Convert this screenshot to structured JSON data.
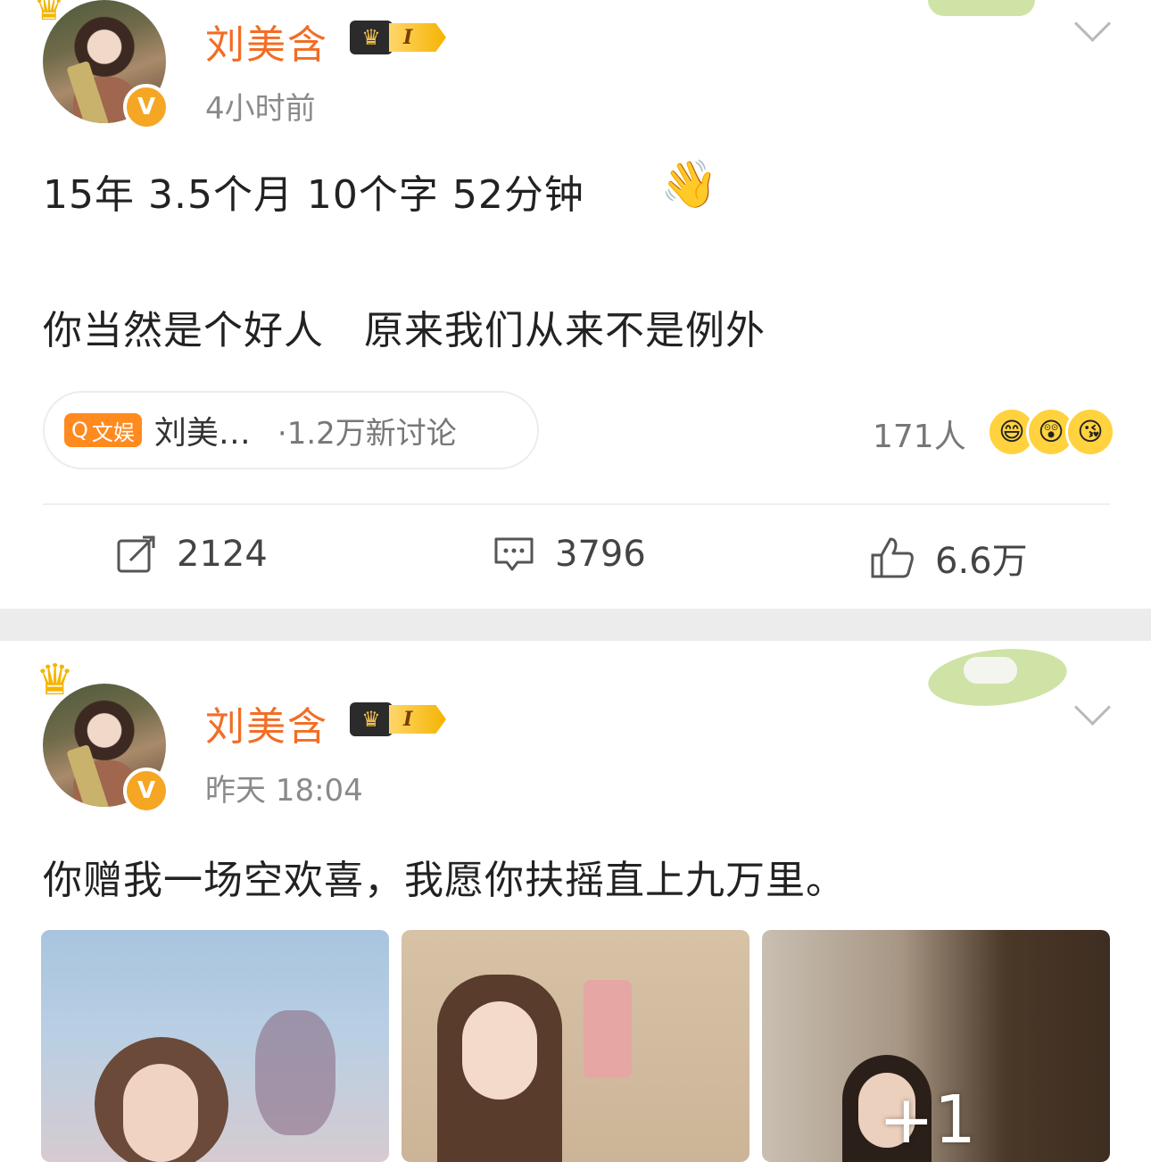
{
  "posts": [
    {
      "username": "刘美含",
      "vip_level": "I",
      "timestamp": "4小时前",
      "verified_badge": "V",
      "lines": [
        "15年 3.5个月 10个字 52分钟",
        "你当然是个好人   原来我们从来不是例外"
      ],
      "emoji": "👋",
      "topic": {
        "tag_label": "文娱",
        "name": "刘美…",
        "count": "·1.2万新讨论"
      },
      "reactions": {
        "count": "171人",
        "faces": [
          "😄",
          "😲",
          "😘"
        ]
      },
      "actions": {
        "repost": "2124",
        "comment": "3796",
        "like": "6.6万"
      }
    },
    {
      "username": "刘美含",
      "vip_level": "I",
      "timestamp": "昨天 18:04",
      "verified_badge": "V",
      "text": "你赠我一场空欢喜，我愿你扶摇直上九万里。",
      "more_images": "+1"
    }
  ],
  "colors": {
    "username": "#f26d25",
    "accent": "#ff8a1f",
    "separator": "#ececec"
  },
  "icons": [
    "crown-icon",
    "chevron-down-icon",
    "repost-icon",
    "comment-icon",
    "like-icon",
    "search-icon"
  ]
}
